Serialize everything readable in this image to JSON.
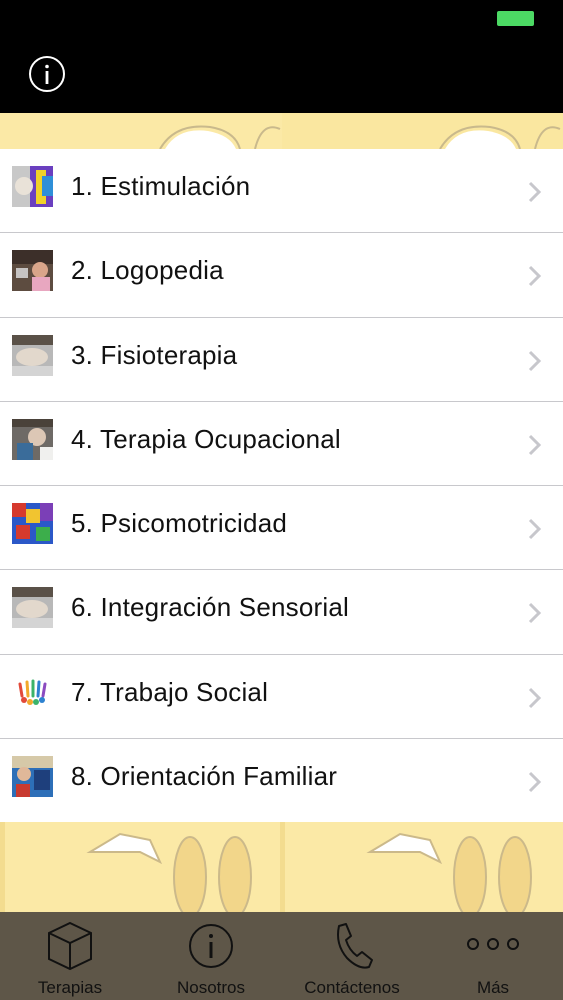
{
  "header": {
    "battery_color": "#4cd964",
    "info_icon": "info-circle-icon"
  },
  "therapies": [
    {
      "label": "1. Estimulación",
      "thumb": "photo-child-colorful"
    },
    {
      "label": "2. Logopedia",
      "thumb": "photo-child-speech"
    },
    {
      "label": "3. Fisioterapia",
      "thumb": "photo-physio"
    },
    {
      "label": "4. Terapia Ocupacional",
      "thumb": "photo-occupational"
    },
    {
      "label": "5. Psicomotricidad",
      "thumb": "photo-play-blocks"
    },
    {
      "label": "6. Integración Sensorial",
      "thumb": "photo-sensory"
    },
    {
      "label": "7. Trabajo Social",
      "thumb": "icon-people-group"
    },
    {
      "label": "8. Orientación Familiar",
      "thumb": "photo-family"
    }
  ],
  "tabbar": {
    "tabs": [
      {
        "label": "Terapias",
        "icon": "cube-icon"
      },
      {
        "label": "Nosotros",
        "icon": "info-circle-icon"
      },
      {
        "label": "Contáctenos",
        "icon": "phone-icon"
      },
      {
        "label": "Más",
        "icon": "more-dots-icon"
      }
    ]
  },
  "colors": {
    "background_yellow": "#fbe9a6",
    "tabbar_bg": "#5e5648",
    "separator": "#c8c8cc"
  }
}
